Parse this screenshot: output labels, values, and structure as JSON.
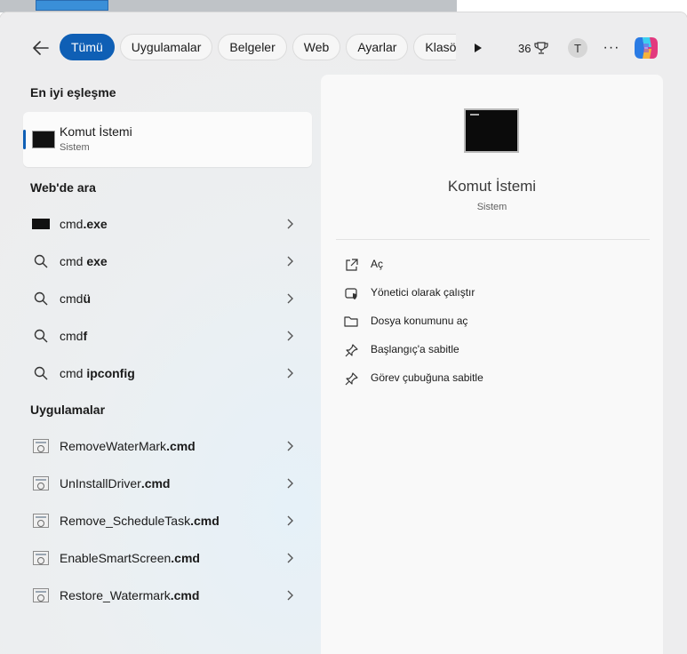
{
  "filter_bar": {
    "tabs": [
      "Tümü",
      "Uygulamalar",
      "Belgeler",
      "Web",
      "Ayarlar",
      "Klasörler"
    ],
    "active_tab": "Tümü",
    "points": "36",
    "avatar_letter": "T",
    "more_label": "···"
  },
  "best_match": {
    "section_title": "En iyi eşleşme",
    "name": "Komut İstemi",
    "subtitle": "Sistem"
  },
  "web": {
    "section_title": "Web'de ara",
    "items": [
      {
        "prefix": "cmd",
        "bold": ".exe",
        "icon": "cmd-thumb-icon"
      },
      {
        "prefix": "cmd ",
        "bold": "exe",
        "icon": "search-icon"
      },
      {
        "prefix": "cmd",
        "bold": "ü",
        "icon": "search-icon"
      },
      {
        "prefix": "cmd",
        "bold": "f",
        "icon": "search-icon"
      },
      {
        "prefix": "cmd ",
        "bold": "ipconfig",
        "icon": "search-icon"
      }
    ]
  },
  "apps": {
    "section_title": "Uygulamalar",
    "items": [
      {
        "prefix": "RemoveWaterMark",
        "bold": ".cmd"
      },
      {
        "prefix": "UnInstallDriver",
        "bold": ".cmd"
      },
      {
        "prefix": "Remove_ScheduleTask",
        "bold": ".cmd"
      },
      {
        "prefix": "EnableSmartScreen",
        "bold": ".cmd"
      },
      {
        "prefix": "Restore_Watermark",
        "bold": ".cmd"
      }
    ]
  },
  "preview": {
    "title": "Komut İstemi",
    "subtitle": "Sistem",
    "actions": [
      {
        "label": "Aç",
        "icon": "open-external-icon"
      },
      {
        "label": "Yönetici olarak çalıştır",
        "icon": "shield-admin-icon"
      },
      {
        "label": "Dosya konumunu aç",
        "icon": "folder-icon"
      },
      {
        "label": "Başlangıç'a sabitle",
        "icon": "pin-icon"
      },
      {
        "label": "Görev çubuğuna sabitle",
        "icon": "pin-icon"
      }
    ]
  },
  "colors": {
    "accent": "#0f5fb5",
    "panel_bg": "#ededee",
    "preview_bg": "#f9f9f9"
  }
}
